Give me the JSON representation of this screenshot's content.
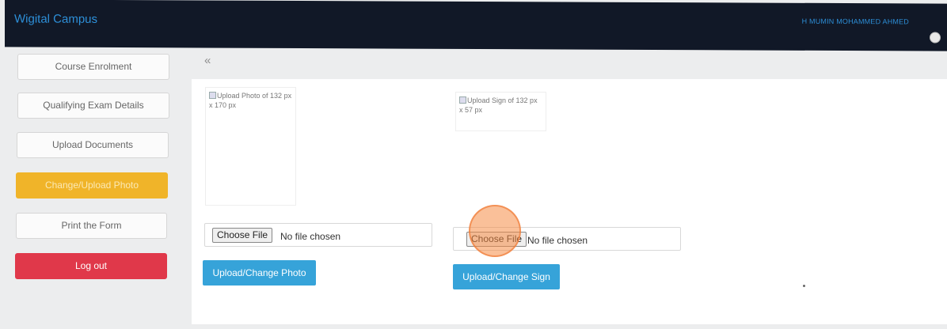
{
  "header": {
    "brand": "Wigital Campus",
    "user_name": "H MUMIN MOHAMMED AHMED"
  },
  "sidebar": {
    "items": [
      {
        "label": "Course Enrolment"
      },
      {
        "label": "Qualifying Exam Details"
      },
      {
        "label": "Upload Documents"
      },
      {
        "label": "Change/Upload Photo"
      },
      {
        "label": "Print the Form"
      },
      {
        "label": "Log out"
      }
    ]
  },
  "main": {
    "collapse_glyph": "«",
    "photo": {
      "placeholder": "Upload Photo of 132 px x 170 px",
      "choose_label": "Choose File",
      "file_status": "No file chosen",
      "upload_label": "Upload/Change Photo"
    },
    "sign": {
      "placeholder": "Upload Sign of 132 px x 57 px",
      "choose_label": "Choose File",
      "file_status": "No file chosen",
      "upload_label": "Upload/Change Sign"
    }
  },
  "icons": {
    "avatar": "user-avatar-icon",
    "collapse": "double-chevron-left-icon",
    "broken_image": "broken-image-icon"
  },
  "colors": {
    "topbar": "#111827",
    "brand": "#2d8fd8",
    "active_item": "#f0b429",
    "logout": "#e0384a",
    "upload_button": "#36a3d9"
  }
}
